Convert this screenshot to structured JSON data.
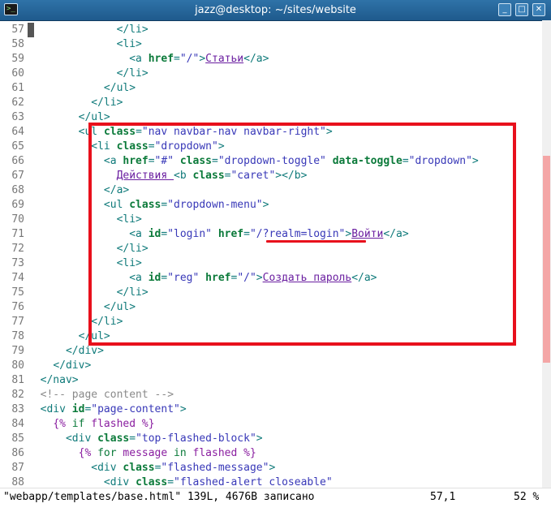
{
  "window": {
    "title": "jazz@desktop: ~/sites/website",
    "app_icon_text": ">_",
    "minimize": "_",
    "maximize": "□",
    "close": "✕"
  },
  "lines": [
    {
      "num": "57",
      "segs": [
        {
          "t": "              "
        },
        {
          "t": "</li>",
          "c": "tag"
        }
      ]
    },
    {
      "num": "58",
      "segs": [
        {
          "t": "              "
        },
        {
          "t": "<li>",
          "c": "tag"
        }
      ]
    },
    {
      "num": "59",
      "segs": [
        {
          "t": "                "
        },
        {
          "t": "<a ",
          "c": "tag"
        },
        {
          "t": "href",
          "c": "attr"
        },
        {
          "t": "=",
          "c": "tag"
        },
        {
          "t": "\"/\"",
          "c": "str"
        },
        {
          "t": ">",
          "c": "tag"
        },
        {
          "t": "Статьи",
          "c": "lnk"
        },
        {
          "t": "</a>",
          "c": "tag"
        }
      ]
    },
    {
      "num": "60",
      "segs": [
        {
          "t": "              "
        },
        {
          "t": "</li>",
          "c": "tag"
        }
      ]
    },
    {
      "num": "61",
      "segs": [
        {
          "t": "            "
        },
        {
          "t": "</ul>",
          "c": "tag"
        }
      ]
    },
    {
      "num": "62",
      "segs": [
        {
          "t": "          "
        },
        {
          "t": "</li>",
          "c": "tag"
        }
      ]
    },
    {
      "num": "63",
      "segs": [
        {
          "t": "        "
        },
        {
          "t": "</ul>",
          "c": "tag"
        }
      ]
    },
    {
      "num": "64",
      "segs": [
        {
          "t": "        "
        },
        {
          "t": "<ul ",
          "c": "tag"
        },
        {
          "t": "class",
          "c": "attr"
        },
        {
          "t": "=",
          "c": "tag"
        },
        {
          "t": "\"nav navbar-nav navbar-right\"",
          "c": "str"
        },
        {
          "t": ">",
          "c": "tag"
        }
      ]
    },
    {
      "num": "65",
      "segs": [
        {
          "t": "          "
        },
        {
          "t": "<li ",
          "c": "tag"
        },
        {
          "t": "class",
          "c": "attr"
        },
        {
          "t": "=",
          "c": "tag"
        },
        {
          "t": "\"dropdown\"",
          "c": "str"
        },
        {
          "t": ">",
          "c": "tag"
        }
      ]
    },
    {
      "num": "66",
      "segs": [
        {
          "t": "            "
        },
        {
          "t": "<a ",
          "c": "tag"
        },
        {
          "t": "href",
          "c": "attr"
        },
        {
          "t": "=",
          "c": "tag"
        },
        {
          "t": "\"#\" ",
          "c": "str"
        },
        {
          "t": "class",
          "c": "attr"
        },
        {
          "t": "=",
          "c": "tag"
        },
        {
          "t": "\"dropdown-toggle\" ",
          "c": "str"
        },
        {
          "t": "data-toggle",
          "c": "attr"
        },
        {
          "t": "=",
          "c": "tag"
        },
        {
          "t": "\"dropdown\"",
          "c": "str"
        },
        {
          "t": ">",
          "c": "tag"
        }
      ]
    },
    {
      "num": "67",
      "segs": [
        {
          "t": "              "
        },
        {
          "t": "Действия ",
          "c": "lnk"
        },
        {
          "t": "<b ",
          "c": "tag"
        },
        {
          "t": "class",
          "c": "attr"
        },
        {
          "t": "=",
          "c": "tag"
        },
        {
          "t": "\"caret\"",
          "c": "str"
        },
        {
          "t": "></b>",
          "c": "tag"
        }
      ]
    },
    {
      "num": "68",
      "segs": [
        {
          "t": "            "
        },
        {
          "t": "</a>",
          "c": "tag"
        }
      ]
    },
    {
      "num": "69",
      "segs": [
        {
          "t": "            "
        },
        {
          "t": "<ul ",
          "c": "tag"
        },
        {
          "t": "class",
          "c": "attr"
        },
        {
          "t": "=",
          "c": "tag"
        },
        {
          "t": "\"dropdown-menu\"",
          "c": "str"
        },
        {
          "t": ">",
          "c": "tag"
        }
      ]
    },
    {
      "num": "70",
      "segs": [
        {
          "t": "              "
        },
        {
          "t": "<li>",
          "c": "tag"
        }
      ]
    },
    {
      "num": "71",
      "segs": [
        {
          "t": "                "
        },
        {
          "t": "<a ",
          "c": "tag"
        },
        {
          "t": "id",
          "c": "attr"
        },
        {
          "t": "=",
          "c": "tag"
        },
        {
          "t": "\"login\" ",
          "c": "str"
        },
        {
          "t": "href",
          "c": "attr"
        },
        {
          "t": "=",
          "c": "tag"
        },
        {
          "t": "\"/?realm=login\"",
          "c": "str"
        },
        {
          "t": ">",
          "c": "tag"
        },
        {
          "t": "Войти",
          "c": "lnk"
        },
        {
          "t": "</a>",
          "c": "tag"
        }
      ]
    },
    {
      "num": "72",
      "segs": [
        {
          "t": "              "
        },
        {
          "t": "</li>",
          "c": "tag"
        }
      ]
    },
    {
      "num": "73",
      "segs": [
        {
          "t": "              "
        },
        {
          "t": "<li>",
          "c": "tag"
        }
      ]
    },
    {
      "num": "74",
      "segs": [
        {
          "t": "                "
        },
        {
          "t": "<a ",
          "c": "tag"
        },
        {
          "t": "id",
          "c": "attr"
        },
        {
          "t": "=",
          "c": "tag"
        },
        {
          "t": "\"reg\" ",
          "c": "str"
        },
        {
          "t": "href",
          "c": "attr"
        },
        {
          "t": "=",
          "c": "tag"
        },
        {
          "t": "\"/\"",
          "c": "str"
        },
        {
          "t": ">",
          "c": "tag"
        },
        {
          "t": "Создать пароль",
          "c": "lnk"
        },
        {
          "t": "</a>",
          "c": "tag"
        }
      ]
    },
    {
      "num": "75",
      "segs": [
        {
          "t": "              "
        },
        {
          "t": "</li>",
          "c": "tag"
        }
      ]
    },
    {
      "num": "76",
      "segs": [
        {
          "t": "            "
        },
        {
          "t": "</ul>",
          "c": "tag"
        }
      ]
    },
    {
      "num": "77",
      "segs": [
        {
          "t": "          "
        },
        {
          "t": "</li>",
          "c": "tag"
        }
      ]
    },
    {
      "num": "78",
      "segs": [
        {
          "t": "        "
        },
        {
          "t": "</ul>",
          "c": "tag"
        }
      ]
    },
    {
      "num": "79",
      "segs": [
        {
          "t": "      "
        },
        {
          "t": "</div>",
          "c": "tag"
        }
      ]
    },
    {
      "num": "80",
      "segs": [
        {
          "t": "    "
        },
        {
          "t": "</div>",
          "c": "tag"
        }
      ]
    },
    {
      "num": "81",
      "segs": [
        {
          "t": "  "
        },
        {
          "t": "</nav>",
          "c": "tag"
        }
      ]
    },
    {
      "num": "82",
      "segs": [
        {
          "t": "  "
        },
        {
          "t": "<!-- page content -->",
          "c": "cmt"
        }
      ]
    },
    {
      "num": "83",
      "segs": [
        {
          "t": "  "
        },
        {
          "t": "<div ",
          "c": "tag"
        },
        {
          "t": "id",
          "c": "attr"
        },
        {
          "t": "=",
          "c": "tag"
        },
        {
          "t": "\"page-content\"",
          "c": "str"
        },
        {
          "t": ">",
          "c": "tag"
        }
      ]
    },
    {
      "num": "84",
      "segs": [
        {
          "t": "    "
        },
        {
          "t": "{% ",
          "c": "jinja"
        },
        {
          "t": "if ",
          "c": "kw"
        },
        {
          "t": "flashed ",
          "c": "jinja"
        },
        {
          "t": "%}",
          "c": "jinja"
        }
      ]
    },
    {
      "num": "85",
      "segs": [
        {
          "t": "      "
        },
        {
          "t": "<div ",
          "c": "tag"
        },
        {
          "t": "class",
          "c": "attr"
        },
        {
          "t": "=",
          "c": "tag"
        },
        {
          "t": "\"top-flashed-block\"",
          "c": "str"
        },
        {
          "t": ">",
          "c": "tag"
        }
      ]
    },
    {
      "num": "86",
      "segs": [
        {
          "t": "        "
        },
        {
          "t": "{% ",
          "c": "jinja"
        },
        {
          "t": "for ",
          "c": "kw"
        },
        {
          "t": "message ",
          "c": "jinja"
        },
        {
          "t": "in ",
          "c": "kw"
        },
        {
          "t": "flashed ",
          "c": "jinja"
        },
        {
          "t": "%}",
          "c": "jinja"
        }
      ]
    },
    {
      "num": "87",
      "segs": [
        {
          "t": "          "
        },
        {
          "t": "<div ",
          "c": "tag"
        },
        {
          "t": "class",
          "c": "attr"
        },
        {
          "t": "=",
          "c": "tag"
        },
        {
          "t": "\"flashed-message\"",
          "c": "str"
        },
        {
          "t": ">",
          "c": "tag"
        }
      ]
    },
    {
      "num": "88",
      "segs": [
        {
          "t": "            "
        },
        {
          "t": "<div ",
          "c": "tag"
        },
        {
          "t": "class",
          "c": "attr"
        },
        {
          "t": "=",
          "c": "tag"
        },
        {
          "t": "\"flashed-alert closeable\"",
          "c": "str"
        }
      ]
    }
  ],
  "status": {
    "file_msg": "\"webapp/templates/base.html\" 139L, 4676B записано",
    "position": "57,1",
    "percent": "52 %"
  },
  "scroll": {
    "position_fraction": 0.52
  }
}
